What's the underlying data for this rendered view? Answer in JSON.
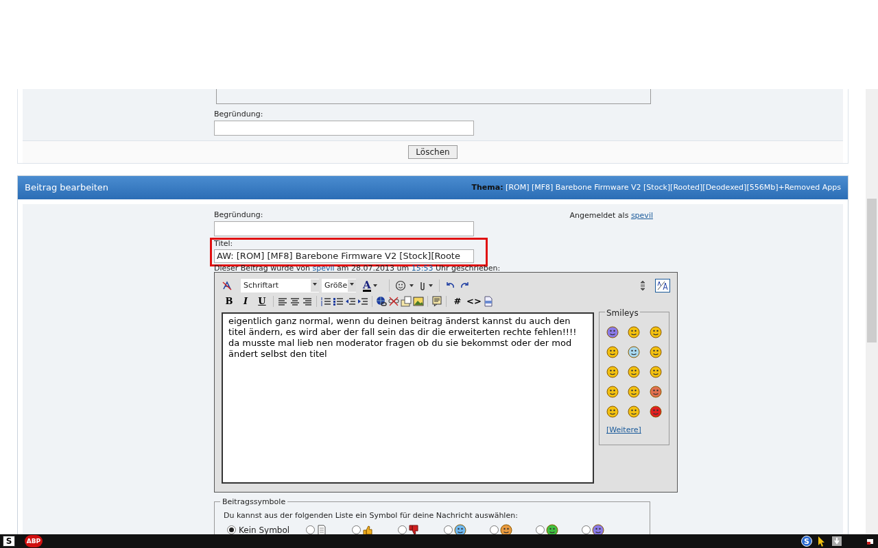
{
  "delete_panel": {
    "reason_label": "Begründung:",
    "button": "Löschen"
  },
  "edit_panel": {
    "header": "Beitrag bearbeiten",
    "topic_label": "Thema:",
    "topic": "[ROM] [MF8] Barebone Firmware V2 [Stock][Rooted][Deodexed][556Mb]+Removed Apps",
    "reason_label": "Begründung:",
    "logged_in_label": "Angemeldet als",
    "user": "spevil",
    "title_label": "Titel:",
    "title_value": "AW: [ROM] [MF8] Barebone Firmware V2 [Stock][Roote",
    "title_highlighted": true,
    "note": [
      "Dieser Beitrag wurde von",
      "spevil",
      "am 28.07.2013 um",
      "15:53",
      "Uhr geschrieben:"
    ]
  },
  "editor": {
    "font_select": "Schriftart",
    "size_select": "Größe",
    "toolbar": [
      {
        "kind": "bold",
        "text": "B"
      },
      {
        "kind": "italic",
        "text": "I"
      },
      {
        "kind": "underline",
        "text": "U"
      },
      {
        "kind": "hash",
        "text": "#"
      },
      {
        "kind": "code",
        "text": "<>"
      }
    ],
    "font_color_letter": "A",
    "message": "eigentlich ganz normal, wenn du deinen beitrag änderst kannst du auch den titel ändern, es wird aber der fall sein das dir die erweiterten rechte fehlen!!!!\nda musste mal lieb nen moderator fragen ob du sie bekommst oder der mod ändert selbst den titel",
    "smileys": {
      "legend": "Smileys",
      "items": [
        {
          "color": "#8a7ae8"
        },
        {
          "color": "#f2c010"
        },
        {
          "color": "#f2c010"
        },
        {
          "color": "#f2c010"
        },
        {
          "color": "#a8d8f0"
        },
        {
          "color": "#f2c010"
        },
        {
          "color": "#f2c010"
        },
        {
          "color": "#f2c010"
        },
        {
          "color": "#f2c010"
        },
        {
          "color": "#f2c010"
        },
        {
          "color": "#f2c010"
        },
        {
          "color": "#e07050"
        },
        {
          "color": "#f2c010"
        },
        {
          "color": "#f2c010"
        },
        {
          "color": "#e02020"
        }
      ],
      "more": "[Weitere]"
    }
  },
  "post_icons": {
    "legend": "Beitragssymbole",
    "hint": "Du kannst aus der folgenden Liste ein Symbol für deine Nachricht auswählen:",
    "options": [
      {
        "kind": "none",
        "label": "Kein Symbol",
        "selected": true
      },
      {
        "kind": "document",
        "selected": false
      },
      {
        "kind": "thumbs-up",
        "selected": false
      },
      {
        "kind": "thumbs-down",
        "selected": false
      },
      {
        "kind": "face",
        "color": "#6fb8f0",
        "selected": false
      },
      {
        "kind": "face",
        "color": "#e89a40",
        "selected": false
      },
      {
        "kind": "face",
        "color": "#40c040",
        "selected": false
      },
      {
        "kind": "face",
        "color": "#8a7ae8",
        "selected": false
      }
    ]
  },
  "taskbar": {
    "start_letter": "S",
    "adblock": "ABP",
    "tray_letter": "S"
  }
}
